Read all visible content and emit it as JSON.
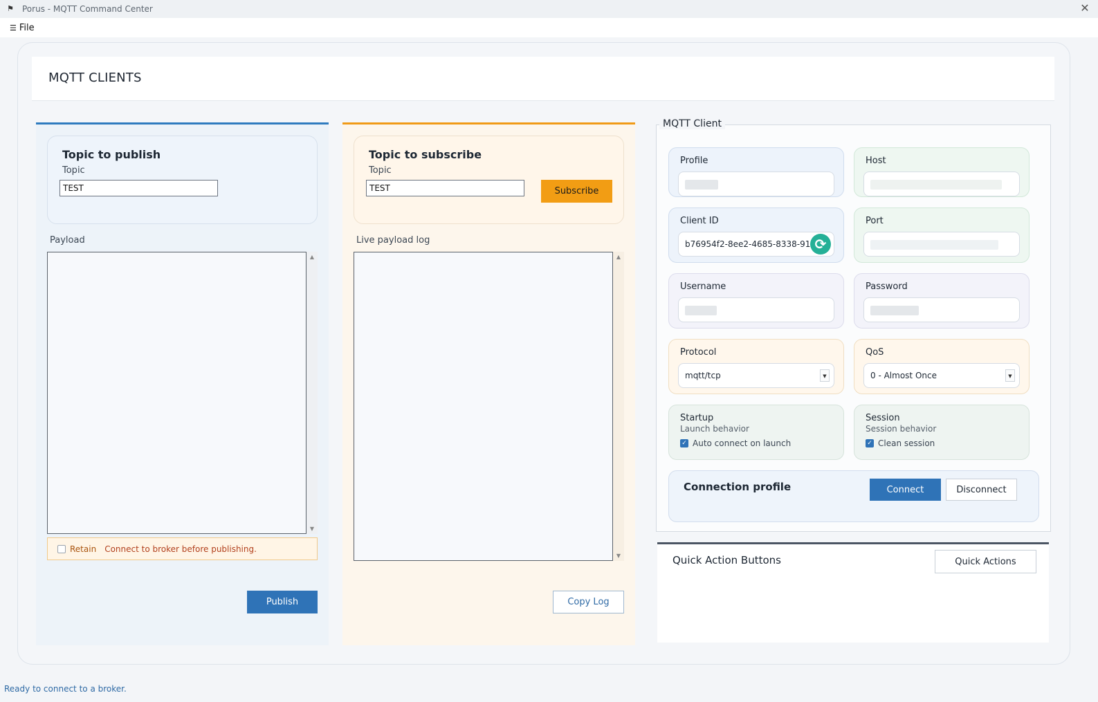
{
  "window": {
    "title": "Porus - MQTT Command Center",
    "close_glyph": "✕"
  },
  "menu": {
    "file_label": "File"
  },
  "header": {
    "title": "MQTT CLIENTS"
  },
  "publish": {
    "card_title": "Topic to publish",
    "topic_label": "Topic",
    "topic_value": "TEST",
    "payload_label": "Payload",
    "retain_label": "Retain",
    "retain_checked": false,
    "warning": "Connect to broker before publishing.",
    "publish_label": "Publish",
    "accent": "#2f7bbf"
  },
  "subscribe": {
    "card_title": "Topic to subscribe",
    "topic_label": "Topic",
    "topic_value": "TEST",
    "subscribe_label": "Subscribe",
    "log_label": "Live payload log",
    "copy_label": "Copy Log",
    "accent": "#f09a17"
  },
  "client": {
    "legend": "MQTT Client",
    "profile_label": "Profile",
    "host_label": "Host",
    "client_id_label": "Client ID",
    "client_id_value": "b76954f2-8ee2-4685-8338-91",
    "port_label": "Port",
    "username_label": "Username",
    "password_label": "Password",
    "protocol_label": "Protocol",
    "protocol_value": "mqtt/tcp",
    "qos_label": "QoS",
    "qos_value": "0 - Almost Once",
    "startup_label": "Startup",
    "startup_sub": "Launch behavior",
    "auto_connect_label": "Auto connect on launch",
    "auto_connect_checked": true,
    "session_label": "Session",
    "session_sub": "Session behavior",
    "clean_session_label": "Clean session",
    "clean_session_checked": true,
    "connection_profile_title": "Connection profile",
    "connect_label": "Connect",
    "disconnect_label": "Disconnect",
    "refresh_icon": "refresh-icon",
    "connect_color": "#2f73b7",
    "refresh_color": "#25b097"
  },
  "quick_actions": {
    "title": "Quick Action Buttons",
    "button_label": "Quick Actions"
  },
  "status": {
    "text": "Ready to connect to a broker."
  }
}
